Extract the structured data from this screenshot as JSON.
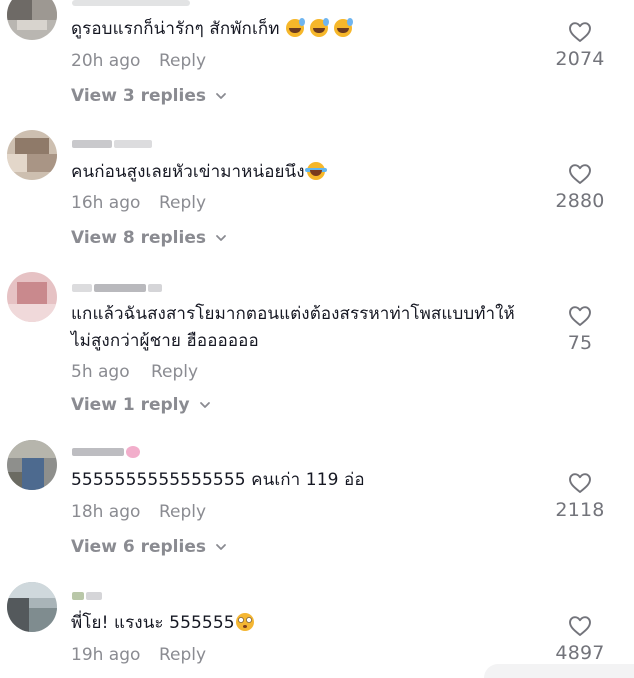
{
  "comments": [
    {
      "text": "ดูรอบแรกก็น่ารักๆ สักพักเก็ท",
      "emojis": [
        "sweat-smile-emoji",
        "sweat-smile-emoji",
        "sweat-smile-emoji"
      ],
      "time": "20h ago",
      "reply_label": "Reply",
      "view_replies": "View 3 replies",
      "likes": "2074"
    },
    {
      "text": "คนก่อนสูงเลยหัวเข่ามาหน่อยนึง",
      "emojis": [
        "laughing-tears-emoji"
      ],
      "time": "16h ago",
      "reply_label": "Reply",
      "view_replies": "View 8 replies",
      "likes": "2880"
    },
    {
      "text": "แกแล้วฉันสงสารโยมากตอนแต่งต้องสรรหาท่าโพสแบบทำให้ไม่สูงกว่าผู้ชาย ฮืออออออ",
      "emojis": [],
      "time": "5h ago",
      "reply_label": "Reply",
      "view_replies": "View 1 reply",
      "likes": "75"
    },
    {
      "text": "5555555555555555 คนเก่า 119 อ่อ",
      "emojis": [],
      "time": "18h ago",
      "reply_label": "Reply",
      "view_replies": "View 6 replies",
      "likes": "2118"
    },
    {
      "text": "พี่โย! แรงนะ 555555",
      "emojis": [
        "flushed-face-emoji"
      ],
      "time": "19h ago",
      "reply_label": "Reply",
      "view_replies": "",
      "likes": "4897"
    }
  ],
  "icons": {
    "like": "heart-outline-icon",
    "expand": "chevron-down-icon"
  },
  "colors": {
    "text": "#161823",
    "meta": "#8a8b91",
    "like_count": "#73747b"
  }
}
